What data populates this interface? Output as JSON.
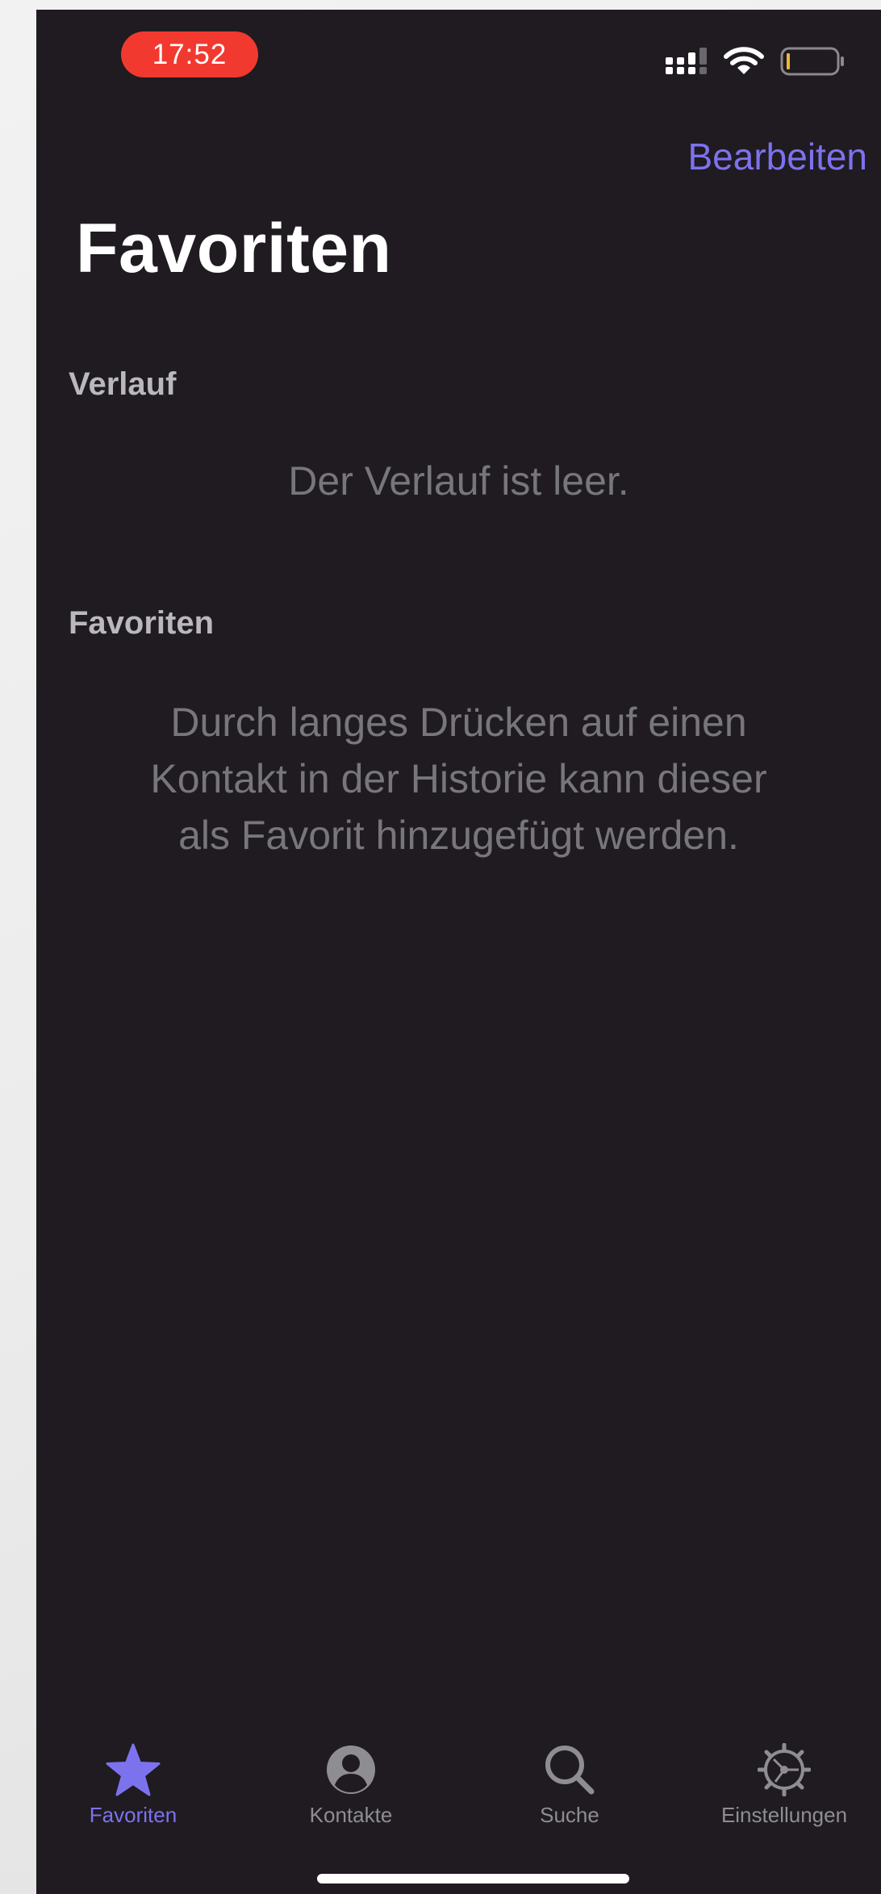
{
  "status_bar": {
    "time": "17:52",
    "icons": [
      "signal-icon",
      "wifi-icon",
      "battery-icon"
    ]
  },
  "nav": {
    "edit_label": "Bearbeiten"
  },
  "page": {
    "title": "Favoriten"
  },
  "sections": {
    "history": {
      "header": "Verlauf",
      "empty_text": "Der Verlauf ist leer."
    },
    "favorites": {
      "header": "Favoriten",
      "empty_lines": [
        "Durch langes Drücken auf einen",
        "Kontakt in der Historie kann dieser",
        "als Favorit hinzugefügt werden."
      ]
    }
  },
  "tabs": [
    {
      "label": "Favoriten",
      "icon": "star-icon",
      "active": true
    },
    {
      "label": "Kontakte",
      "icon": "person-circle-icon",
      "active": false
    },
    {
      "label": "Suche",
      "icon": "search-icon",
      "active": false
    },
    {
      "label": "Einstellungen",
      "icon": "gear-icon",
      "active": false
    }
  ],
  "colors": {
    "background": "#1f1b21",
    "accent": "#7d72ee",
    "time_pill": "#f2392f",
    "inactive_tab": "#8e8d92",
    "placeholder_text": "#77767b"
  }
}
